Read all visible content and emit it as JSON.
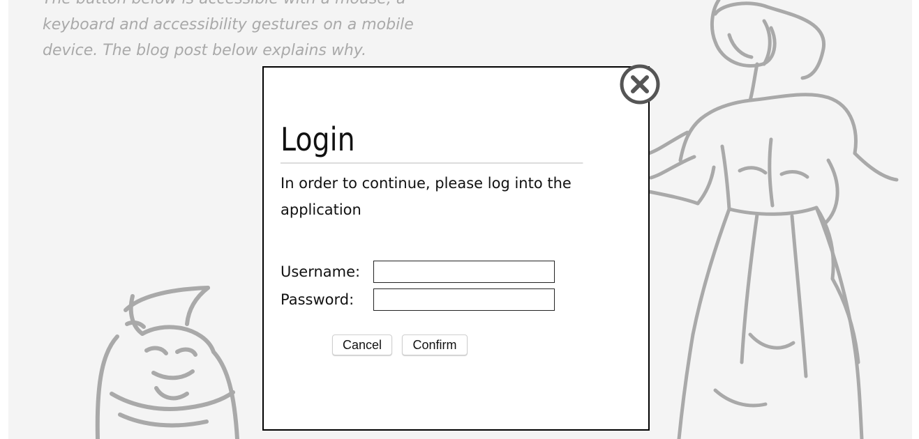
{
  "background": {
    "intro_text": "The button below is accessible with a mouse, a keyboard and accessibility gestures on a mobile device. The blog post below explains why."
  },
  "dialog": {
    "title": "Login",
    "description": "In order to continue, please log into the application",
    "username_label": "Username:",
    "username_value": "",
    "password_label": "Password:",
    "password_value": "",
    "cancel_label": "Cancel",
    "confirm_label": "Confirm",
    "close_icon": "close-circle-icon"
  },
  "colors": {
    "page_background": "#f4f4f4",
    "intro_text": "#a9a9a9",
    "illustration": "#a9a9a9",
    "dialog_background": "#ffffff",
    "dialog_border": "#000000",
    "close_icon": "#555555"
  }
}
